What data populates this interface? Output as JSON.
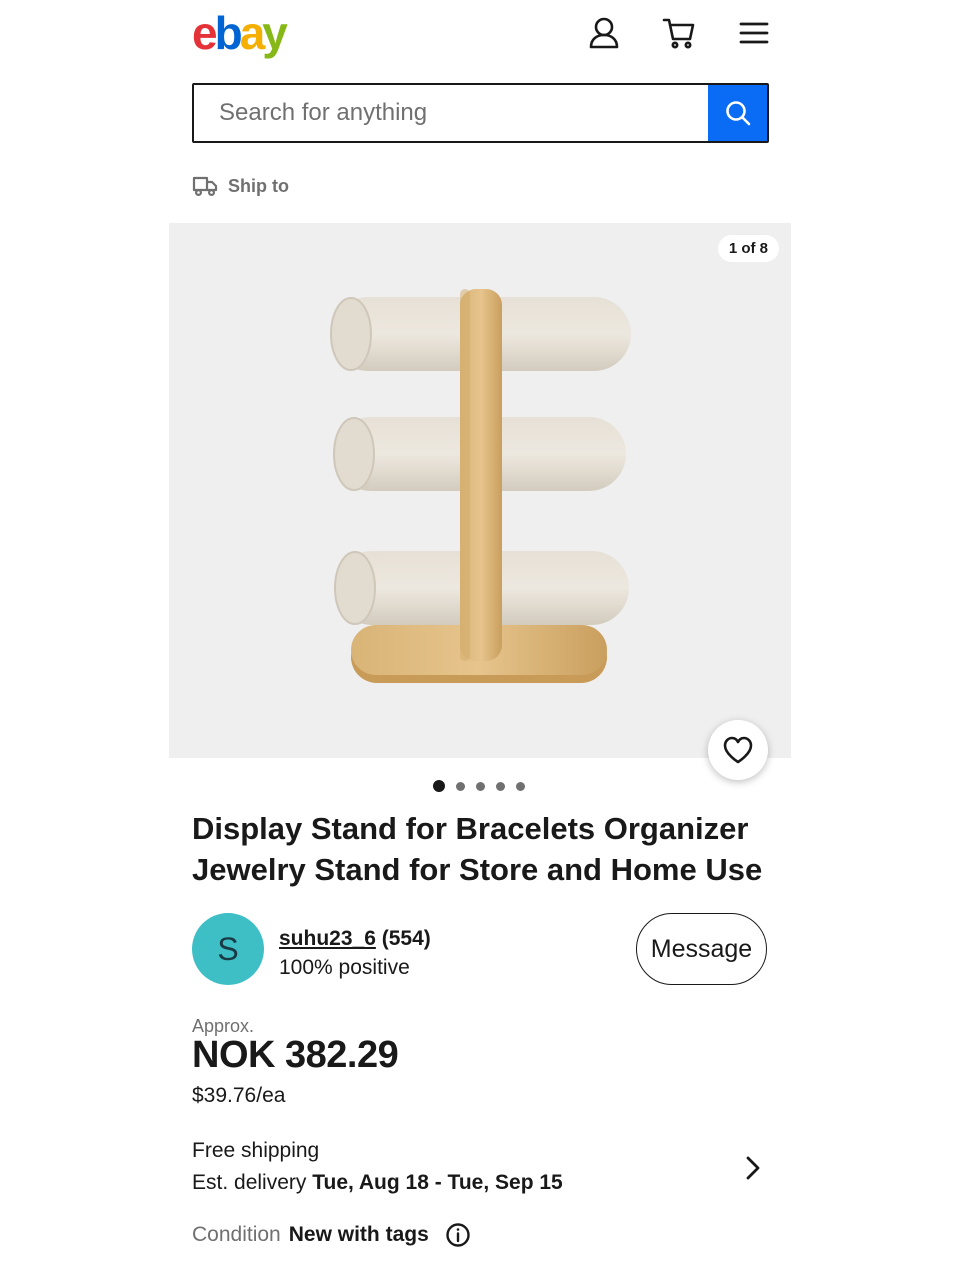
{
  "header": {
    "logo_letters": [
      "e",
      "b",
      "a",
      "y"
    ],
    "icons": [
      "user-icon",
      "cart-icon",
      "hamburger-menu-icon"
    ]
  },
  "search": {
    "placeholder": "Search for anything",
    "button_icon": "search-icon"
  },
  "ship_to": {
    "label": "Ship to",
    "icon": "truck-icon"
  },
  "gallery": {
    "counter": "1 of 8",
    "dots_total": 5,
    "active_dot": 1,
    "favorite_icon": "heart-icon"
  },
  "product": {
    "title": "Display Stand for Bracelets Organizer Jewelry Stand for Store and Home Use"
  },
  "seller": {
    "avatar_letter": "S",
    "name": "suhu23_6",
    "feedback_count": "(554)",
    "positive": "100% positive",
    "message_button": "Message"
  },
  "price": {
    "approx_label": "Approx.",
    "amount": "NOK 382.29",
    "usd_each": "$39.76/ea"
  },
  "shipping": {
    "free": "Free shipping",
    "est_label": "Est. delivery",
    "est_dates": "Tue, Aug 18 - Tue, Sep 15"
  },
  "condition": {
    "label": "Condition",
    "value": "New with tags",
    "info_icon": "info-icon"
  },
  "colors": {
    "search_button": "#0a6cf5",
    "avatar": "#3ebfc6",
    "ebay_e": "#e53238",
    "ebay_b": "#0064d2",
    "ebay_a": "#f5af02",
    "ebay_y": "#86b817"
  }
}
